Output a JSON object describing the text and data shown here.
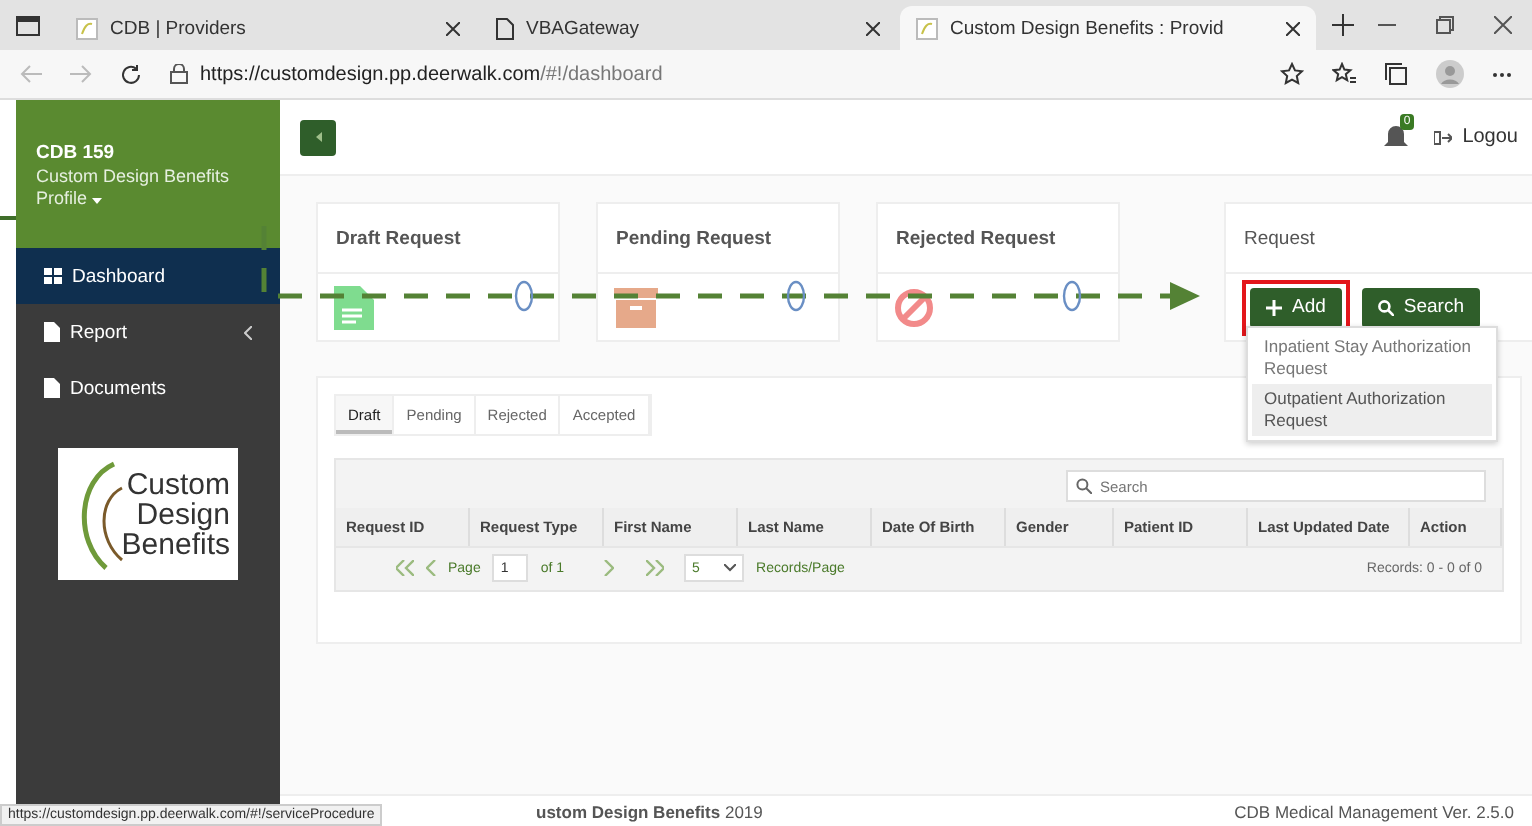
{
  "browser": {
    "tabs": [
      {
        "title": "CDB | Providers",
        "kind": "logo",
        "selected": false
      },
      {
        "title": "VBAGateway",
        "kind": "page",
        "selected": false
      },
      {
        "title": "Custom Design Benefits : Provid",
        "kind": "logo",
        "selected": true
      }
    ],
    "url_host": "https://customdesign.pp.deerwalk.com",
    "url_path": "/#!/dashboard"
  },
  "sidebar": {
    "user": "CDB 159",
    "org": "Custom Design Benefits",
    "profile": "Profile",
    "items": [
      {
        "label": "Dashboard",
        "kind": "grid",
        "selected": true,
        "submenu": false
      },
      {
        "label": "Report",
        "kind": "file",
        "selected": false,
        "submenu": true
      },
      {
        "label": "Documents",
        "kind": "file",
        "selected": false,
        "submenu": false
      }
    ],
    "logo": [
      "Custom",
      "Design",
      "Benefits"
    ]
  },
  "topbar": {
    "notifications": "0",
    "logout": "Logou"
  },
  "cards": [
    {
      "title": "Draft Request",
      "kind": "draft"
    },
    {
      "title": "Pending Request",
      "kind": "pending"
    },
    {
      "title": "Rejected Request",
      "kind": "rejected"
    }
  ],
  "request": {
    "title": "Request",
    "add": "Add",
    "search": "Search",
    "highlighted": true,
    "menu": [
      {
        "label": "Inpatient Stay Authorization Request",
        "selected": false
      },
      {
        "label": "Outpatient Authorization Request",
        "selected": true
      }
    ]
  },
  "tabs": [
    {
      "label": "Draft",
      "selected": true
    },
    {
      "label": "Pending",
      "selected": false
    },
    {
      "label": "Rejected",
      "selected": false
    },
    {
      "label": "Accepted",
      "selected": false
    }
  ],
  "table": {
    "search": {
      "placeholder": "Search"
    },
    "columns": [
      "Request ID",
      "Request Type",
      "First Name",
      "Last Name",
      "Date Of Birth",
      "Gender",
      "Patient ID",
      "Last Updated Date",
      "Action"
    ],
    "pagination": {
      "page_label": "Page",
      "page": "1",
      "of": "of 1",
      "per_page": "5",
      "per_page_label": "Records/Page",
      "records": "Records: 0 - 0 of 0"
    }
  },
  "footer": {
    "left": "**ustom Design Benefits** 2019",
    "right": "CDB Medical Management Ver. 2.5.0"
  },
  "status_url": "https://customdesign.pp.deerwalk.com/#!/serviceProcedure"
}
